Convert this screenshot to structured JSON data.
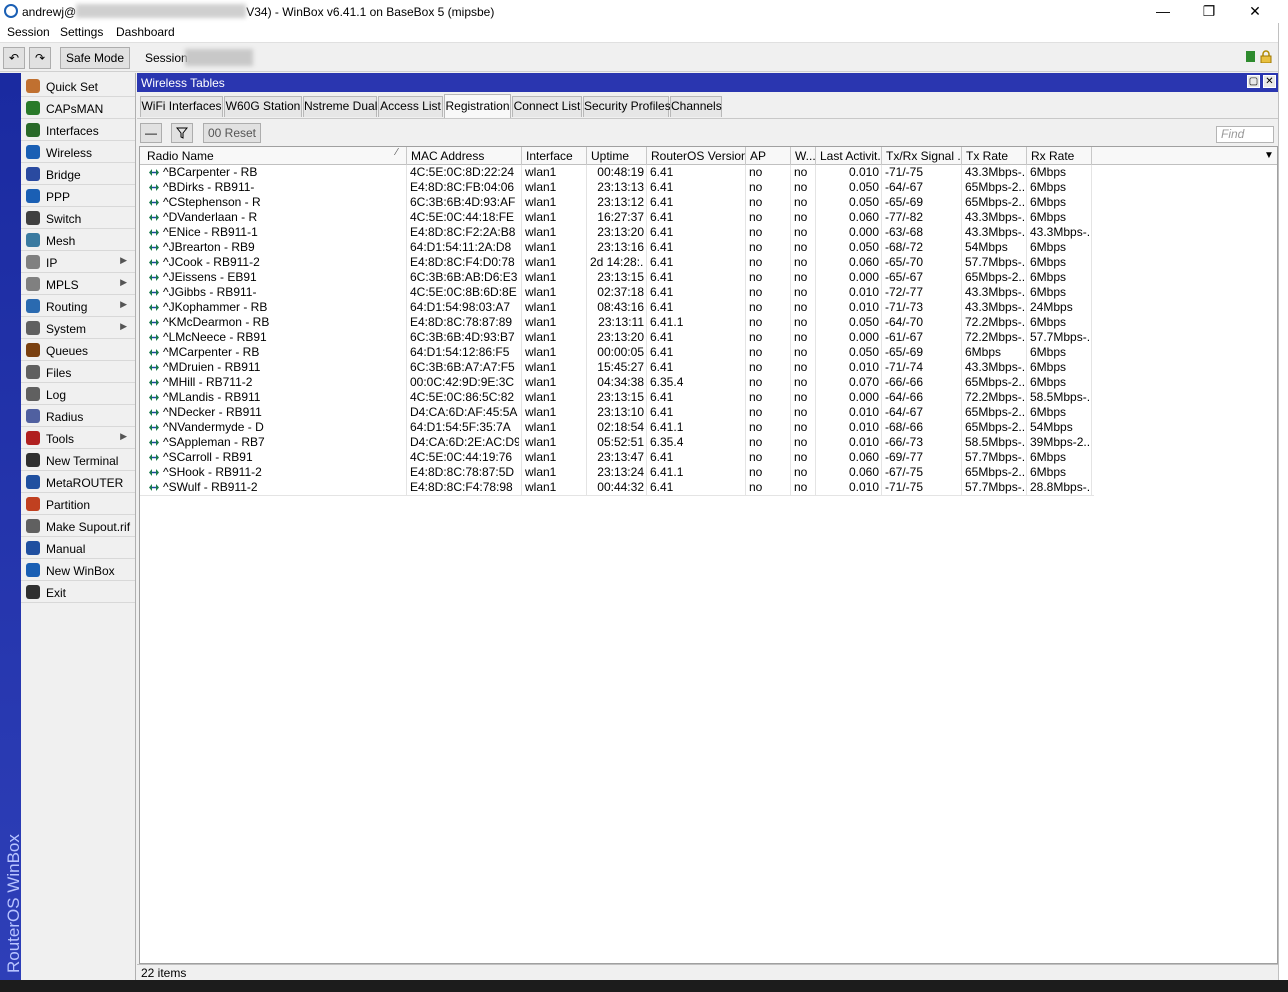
{
  "window": {
    "title_prefix": "andrewj@",
    "title_suffix": "V34) - WinBox v6.41.1 on BaseBox 5 (mipsbe)",
    "minimize": "—",
    "restore": "❐",
    "close": "✕"
  },
  "menu": {
    "session": "Session",
    "settings": "Settings",
    "dashboard": "Dashboard"
  },
  "toolbar": {
    "undo": "↶",
    "redo": "↷",
    "safe_mode": "Safe Mode",
    "session_label": "Session:"
  },
  "brand": "RouterOS WinBox",
  "sidebar": [
    {
      "label": "Quick Set",
      "icon": "quick-set-icon",
      "arrow": ""
    },
    {
      "label": "CAPsMAN",
      "icon": "capsman-icon",
      "arrow": ""
    },
    {
      "label": "Interfaces",
      "icon": "interfaces-icon",
      "arrow": ""
    },
    {
      "label": "Wireless",
      "icon": "wireless-icon",
      "arrow": ""
    },
    {
      "label": "Bridge",
      "icon": "bridge-icon",
      "arrow": ""
    },
    {
      "label": "PPP",
      "icon": "ppp-icon",
      "arrow": ""
    },
    {
      "label": "Switch",
      "icon": "switch-icon",
      "arrow": ""
    },
    {
      "label": "Mesh",
      "icon": "mesh-icon",
      "arrow": ""
    },
    {
      "label": "IP",
      "icon": "ip-icon",
      "arrow": "▶"
    },
    {
      "label": "MPLS",
      "icon": "mpls-icon",
      "arrow": "▶"
    },
    {
      "label": "Routing",
      "icon": "routing-icon",
      "arrow": "▶"
    },
    {
      "label": "System",
      "icon": "system-icon",
      "arrow": "▶"
    },
    {
      "label": "Queues",
      "icon": "queues-icon",
      "arrow": ""
    },
    {
      "label": "Files",
      "icon": "files-icon",
      "arrow": ""
    },
    {
      "label": "Log",
      "icon": "log-icon",
      "arrow": ""
    },
    {
      "label": "Radius",
      "icon": "radius-icon",
      "arrow": ""
    },
    {
      "label": "Tools",
      "icon": "tools-icon",
      "arrow": "▶"
    },
    {
      "label": "New Terminal",
      "icon": "terminal-icon",
      "arrow": ""
    },
    {
      "label": "MetaROUTER",
      "icon": "metarouter-icon",
      "arrow": ""
    },
    {
      "label": "Partition",
      "icon": "partition-icon",
      "arrow": ""
    },
    {
      "label": "Make Supout.rif",
      "icon": "supout-icon",
      "arrow": ""
    },
    {
      "label": "Manual",
      "icon": "manual-icon",
      "arrow": ""
    },
    {
      "label": "New WinBox",
      "icon": "winbox-icon",
      "arrow": ""
    },
    {
      "label": "Exit",
      "icon": "exit-icon",
      "arrow": ""
    }
  ],
  "panel": {
    "title": "Wireless Tables",
    "tabs": [
      "WiFi Interfaces",
      "W60G Station",
      "Nstreme Dual",
      "Access List",
      "Registration",
      "Connect List",
      "Security Profiles",
      "Channels"
    ],
    "active_tab": "Registration",
    "reset_label": "00 Reset",
    "find_placeholder": "Find",
    "status": "22 items"
  },
  "table": {
    "columns": [
      "Radio Name",
      "MAC Address",
      "Interface",
      "Uptime",
      "RouterOS Version",
      "AP",
      "W...",
      "Last Activit...",
      "Tx/Rx Signal ...",
      "Tx Rate",
      "Rx Rate"
    ],
    "rows": [
      [
        "^BCarpenter - RB",
        "4C:5E:0C:8D:22:24",
        "wlan1",
        "00:48:19",
        "6.41",
        "no",
        "no",
        "0.010",
        "-71/-75",
        "43.3Mbps-...",
        "6Mbps"
      ],
      [
        "^BDirks - RB911-",
        "E4:8D:8C:FB:04:06",
        "wlan1",
        "23:13:13",
        "6.41",
        "no",
        "no",
        "0.050",
        "-64/-67",
        "65Mbps-2...",
        "6Mbps"
      ],
      [
        "^CStephenson - R",
        "6C:3B:6B:4D:93:AF",
        "wlan1",
        "23:13:12",
        "6.41",
        "no",
        "no",
        "0.050",
        "-65/-69",
        "65Mbps-2...",
        "6Mbps"
      ],
      [
        "^DVanderlaan - R",
        "4C:5E:0C:44:18:FE",
        "wlan1",
        "16:27:37",
        "6.41",
        "no",
        "no",
        "0.060",
        "-77/-82",
        "43.3Mbps-...",
        "6Mbps"
      ],
      [
        "^ENice - RB911-1",
        "E4:8D:8C:F2:2A:B8",
        "wlan1",
        "23:13:20",
        "6.41",
        "no",
        "no",
        "0.000",
        "-63/-68",
        "43.3Mbps-...",
        "43.3Mbps-..."
      ],
      [
        "^JBrearton - RB9",
        "64:D1:54:11:2A:D8",
        "wlan1",
        "23:13:16",
        "6.41",
        "no",
        "no",
        "0.050",
        "-68/-72",
        "54Mbps",
        "6Mbps"
      ],
      [
        "^JCook - RB911-2",
        "E4:8D:8C:F4:D0:78",
        "wlan1",
        "2d 14:28:...",
        "6.41",
        "no",
        "no",
        "0.060",
        "-65/-70",
        "57.7Mbps-...",
        "6Mbps"
      ],
      [
        "^JEissens - EB91",
        "6C:3B:6B:AB:D6:E3",
        "wlan1",
        "23:13:15",
        "6.41",
        "no",
        "no",
        "0.000",
        "-65/-67",
        "65Mbps-2...",
        "6Mbps"
      ],
      [
        "^JGibbs - RB911-",
        "4C:5E:0C:8B:6D:8E",
        "wlan1",
        "02:37:18",
        "6.41",
        "no",
        "no",
        "0.010",
        "-72/-77",
        "43.3Mbps-...",
        "6Mbps"
      ],
      [
        "^JKophammer - RB",
        "64:D1:54:98:03:A7",
        "wlan1",
        "08:43:16",
        "6.41",
        "no",
        "no",
        "0.010",
        "-71/-73",
        "43.3Mbps-...",
        "24Mbps"
      ],
      [
        "^KMcDearmon - RB",
        "E4:8D:8C:78:87:89",
        "wlan1",
        "23:13:11",
        "6.41.1",
        "no",
        "no",
        "0.050",
        "-64/-70",
        "72.2Mbps-...",
        "6Mbps"
      ],
      [
        "^LMcNeece - RB91",
        "6C:3B:6B:4D:93:B7",
        "wlan1",
        "23:13:20",
        "6.41",
        "no",
        "no",
        "0.000",
        "-61/-67",
        "72.2Mbps-...",
        "57.7Mbps-..."
      ],
      [
        "^MCarpenter - RB",
        "64:D1:54:12:86:F5",
        "wlan1",
        "00:00:05",
        "6.41",
        "no",
        "no",
        "0.050",
        "-65/-69",
        "6Mbps",
        "6Mbps"
      ],
      [
        "^MDruien - RB911",
        "6C:3B:6B:A7:A7:F5",
        "wlan1",
        "15:45:27",
        "6.41",
        "no",
        "no",
        "0.010",
        "-71/-74",
        "43.3Mbps-...",
        "6Mbps"
      ],
      [
        "^MHill - RB711-2",
        "00:0C:42:9D:9E:3C",
        "wlan1",
        "04:34:38",
        "6.35.4",
        "no",
        "no",
        "0.070",
        "-66/-66",
        "65Mbps-2...",
        "6Mbps"
      ],
      [
        "^MLandis - RB911",
        "4C:5E:0C:86:5C:82",
        "wlan1",
        "23:13:15",
        "6.41",
        "no",
        "no",
        "0.000",
        "-64/-66",
        "72.2Mbps-...",
        "58.5Mbps-..."
      ],
      [
        "^NDecker - RB911",
        "D4:CA:6D:AF:45:5A",
        "wlan1",
        "23:13:10",
        "6.41",
        "no",
        "no",
        "0.010",
        "-64/-67",
        "65Mbps-2...",
        "6Mbps"
      ],
      [
        "^NVandermyde - D",
        "64:D1:54:5F:35:7A",
        "wlan1",
        "02:18:54",
        "6.41.1",
        "no",
        "no",
        "0.010",
        "-68/-66",
        "65Mbps-2...",
        "54Mbps"
      ],
      [
        "^SAppleman - RB7",
        "D4:CA:6D:2E:AC:D9",
        "wlan1",
        "05:52:51",
        "6.35.4",
        "no",
        "no",
        "0.010",
        "-66/-73",
        "58.5Mbps-...",
        "39Mbps-2..."
      ],
      [
        "^SCarroll - RB91",
        "4C:5E:0C:44:19:76",
        "wlan1",
        "23:13:47",
        "6.41",
        "no",
        "no",
        "0.060",
        "-69/-77",
        "57.7Mbps-...",
        "6Mbps"
      ],
      [
        "^SHook - RB911-2",
        "E4:8D:8C:78:87:5D",
        "wlan1",
        "23:13:24",
        "6.41.1",
        "no",
        "no",
        "0.060",
        "-67/-75",
        "65Mbps-2...",
        "6Mbps"
      ],
      [
        "^SWulf - RB911-2",
        "E4:8D:8C:F4:78:98",
        "wlan1",
        "00:44:32",
        "6.41",
        "no",
        "no",
        "0.010",
        "-71/-75",
        "57.7Mbps-...",
        "28.8Mbps-..."
      ]
    ]
  }
}
